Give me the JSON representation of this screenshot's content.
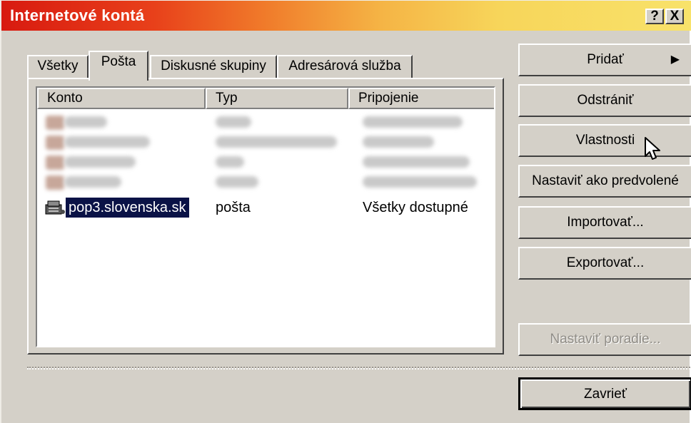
{
  "window": {
    "title": "Internetové kontá",
    "help_label": "?",
    "close_label": "X"
  },
  "tabs": [
    {
      "label": "Všetky"
    },
    {
      "label": "Pošta"
    },
    {
      "label": "Diskusné skupiny"
    },
    {
      "label": "Adresárová služba"
    }
  ],
  "columns": [
    "Konto",
    "Typ",
    "Pripojenie"
  ],
  "selected_account": {
    "name": "pop3.slovenska.sk",
    "type": "pošta",
    "connection": "Všetky dostupné"
  },
  "buttons": {
    "add": "Pridať",
    "remove": "Odstrániť",
    "properties": "Vlastnosti",
    "set_default": "Nastaviť ako predvolené",
    "import": "Importovať...",
    "export": "Exportovať...",
    "set_order": "Nastaviť poradie...",
    "close": "Zavrieť"
  },
  "colors": {
    "title_start": "#d81a10",
    "title_end": "#f8e26a",
    "selection": "#0a1246",
    "face": "#d4d0c8"
  },
  "icons": {
    "account": "mail-server-icon",
    "add_arrow": "triangle-right-icon",
    "cursor": "arrow-cursor-icon"
  }
}
